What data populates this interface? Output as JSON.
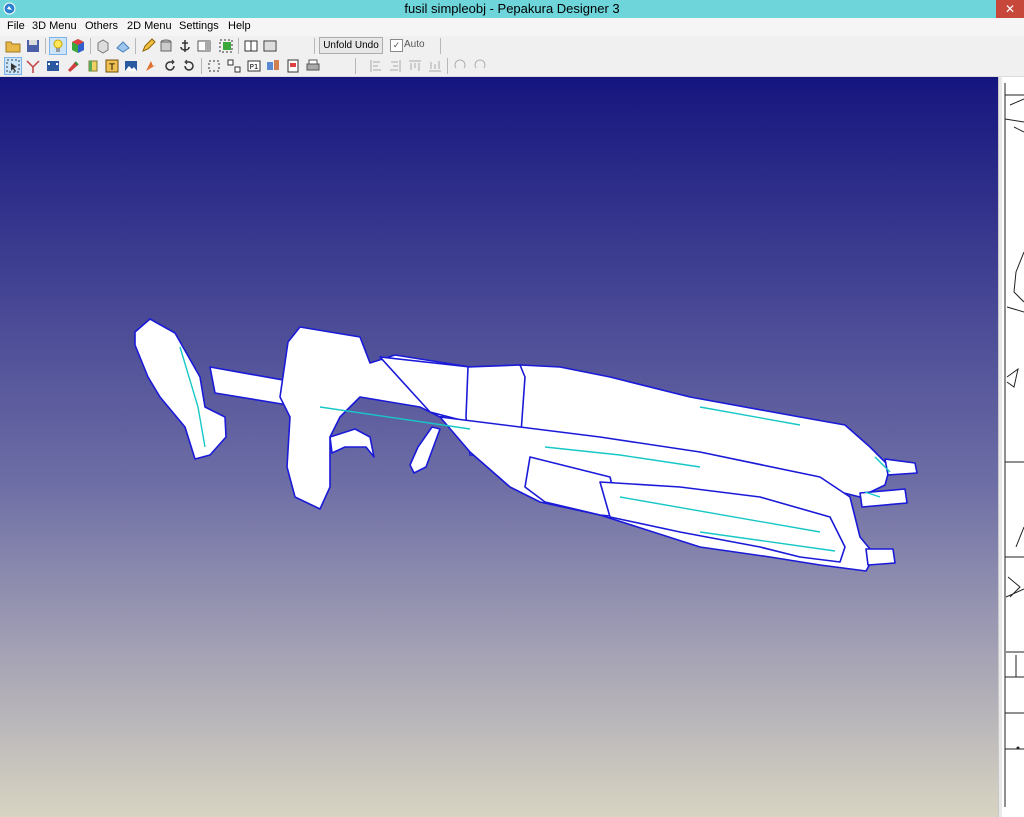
{
  "window": {
    "title": "fusil simpleobj - Pepakura Designer 3"
  },
  "menu": [
    {
      "id": "file",
      "label": "File"
    },
    {
      "id": "3d",
      "label": "3D Menu"
    },
    {
      "id": "others",
      "label": "Others"
    },
    {
      "id": "2d",
      "label": "2D Menu"
    },
    {
      "id": "settings",
      "label": "Settings"
    },
    {
      "id": "help",
      "label": "Help"
    }
  ],
  "toolbar": {
    "unfold_undo_label": "Unfold Undo",
    "auto_label": "Auto",
    "auto_checked": true
  },
  "colors": {
    "titlebar": "#6ed6db",
    "viewport_top": "#15157f",
    "viewport_mid": "#6e6ea6",
    "viewport_bottom": "#d8d4c2",
    "model_fill": "#ffffff",
    "model_edge": "#1a1ad8",
    "model_highlight": "#17c7c7"
  }
}
